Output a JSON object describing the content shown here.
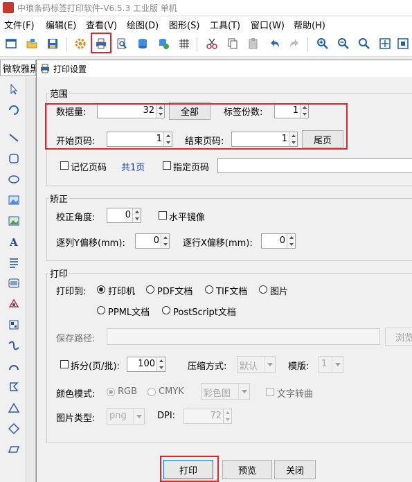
{
  "titlebar": {
    "title": "中琅条码标签打印软件-V6.5.3 工业版 单机"
  },
  "menubar": [
    "文件(F)",
    "编辑(E)",
    "查看(V)",
    "绘图(D)",
    "图形(S)",
    "工具(T)",
    "窗口(W)",
    "帮助(H)"
  ],
  "toolbar": {
    "icons": [
      "new-icon",
      "open-icon",
      "save-icon",
      "settings-icon",
      "print-icon",
      "print-preview-icon",
      "database-icon",
      "database-settings-icon",
      "grid-icon",
      "cut-icon",
      "copy-icon",
      "paste-icon",
      "undo-icon",
      "redo-icon",
      "zoom-in-icon",
      "zoom-out-icon",
      "zoom-icon",
      "fit-page-icon",
      "actual-size-icon"
    ]
  },
  "font_box": {
    "value": "微软雅黑"
  },
  "dialog": {
    "title": "打印设置",
    "range": {
      "group_label": "范围",
      "quantity_label": "数据量:",
      "quantity_value": "32",
      "all_button": "全部",
      "copies_label": "标签份数:",
      "copies_value": "1",
      "start_page_label": "开始页码:",
      "start_page_value": "1",
      "end_page_label": "结束页码:",
      "end_page_value": "1",
      "last_page_button": "尾页",
      "remember_page_label": "记忆页码",
      "total_pages": "共1页",
      "specify_page_label": "指定页码"
    },
    "correction": {
      "group_label": "矫正",
      "angle_label": "校正角度:",
      "angle_value": "0",
      "mirror_label": "水平镜像",
      "y_offset_label": "逐列Y偏移(mm):",
      "y_offset_value": "0",
      "x_offset_label": "逐行X偏移(mm):",
      "x_offset_value": "0"
    },
    "print": {
      "group_label": "打印",
      "print_to_label": "打印到:",
      "targets": [
        "打印机",
        "PDF文档",
        "TIF文档",
        "图片",
        "PPML文档",
        "PostScript文档"
      ],
      "selected_target": "打印机",
      "save_path_label": "保存路径:",
      "browse_button": "浏览",
      "split_label": "拆分(页/批):",
      "split_value": "100",
      "compression_label": "压缩方式:",
      "compression_value": "默认",
      "template_label": "模版:",
      "template_value": "1",
      "color_mode_label": "颜色模式:",
      "color_modes": [
        "RGB",
        "CMYK"
      ],
      "selected_color_mode": "RGB",
      "color_image_value": "彩色图",
      "text_to_curve_label": "文字转曲",
      "image_type_label": "图片类型:",
      "image_type_value": "png",
      "dpi_label": "DPI:",
      "dpi_value": "72"
    },
    "buttons": {
      "print": "打印",
      "preview": "预览",
      "close": "关闭"
    }
  },
  "colors": {
    "highlight": "#e0282c",
    "accent": "#0078d7",
    "link_text": "#1a3cb8"
  }
}
